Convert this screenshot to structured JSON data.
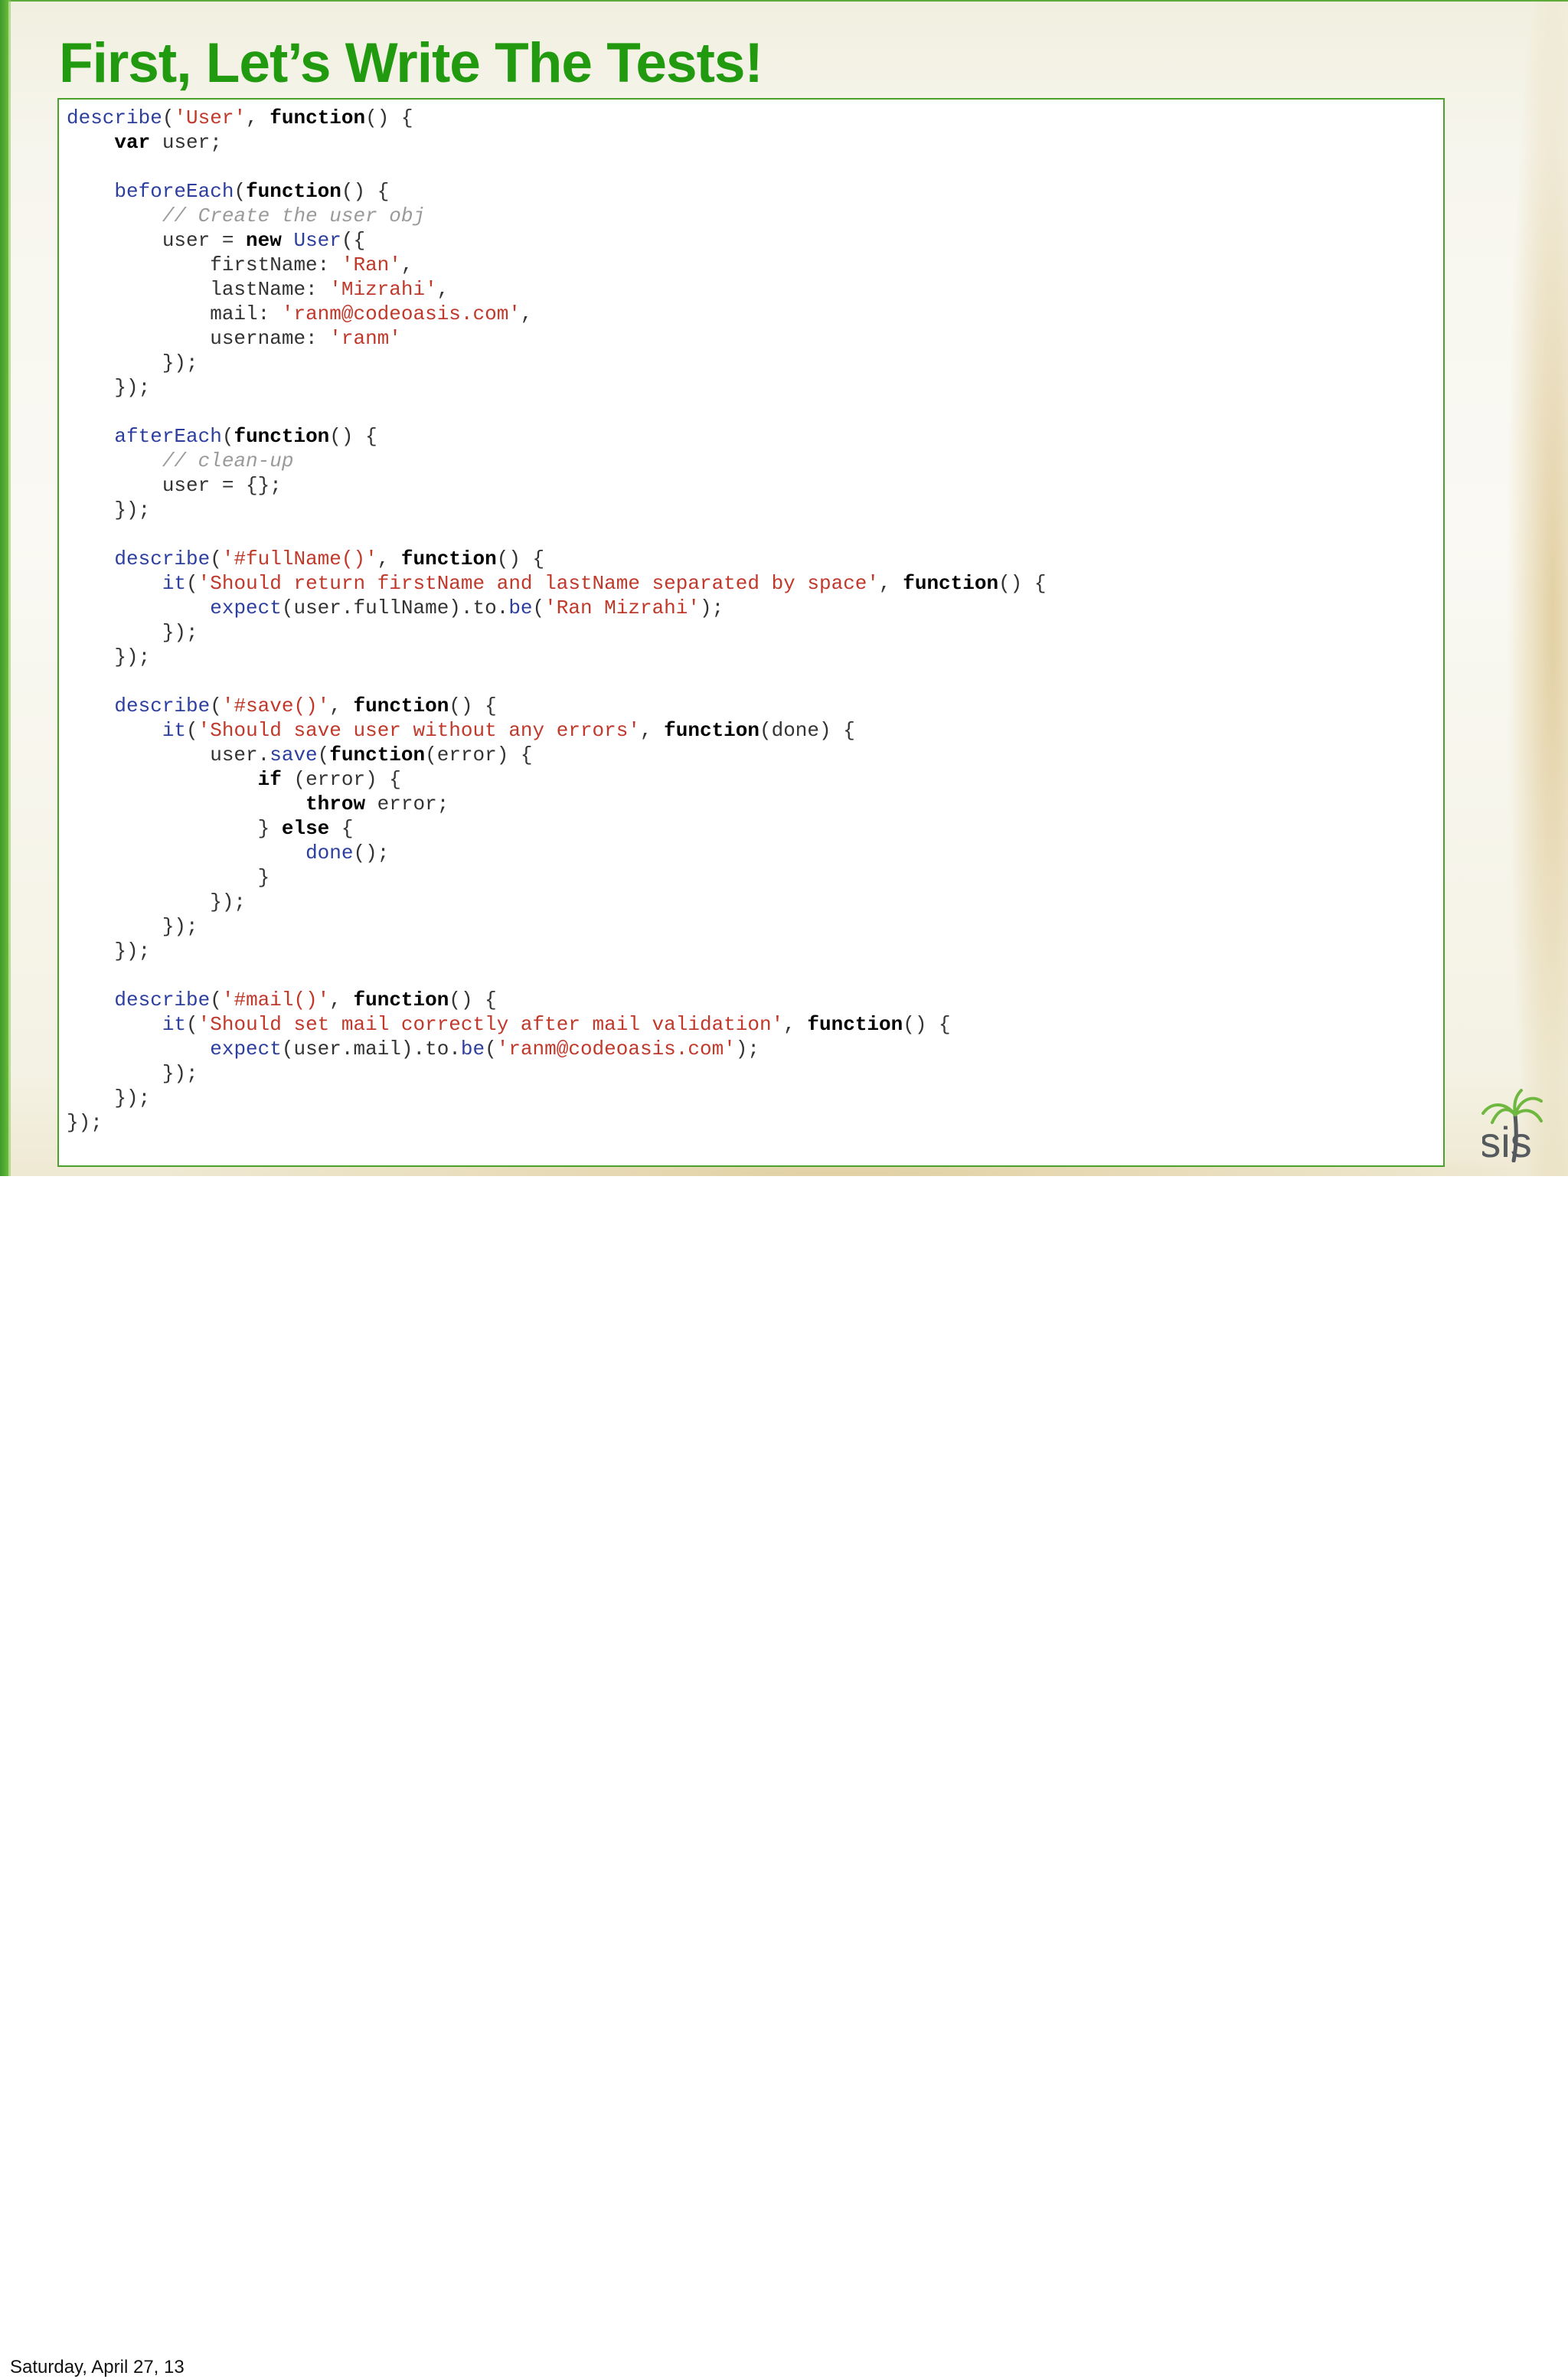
{
  "slide": {
    "title": "First, Let’s Write The Tests!",
    "code_lines": [
      [
        [
          "f",
          "describe"
        ],
        [
          "p",
          "("
        ],
        [
          "s",
          "'User'"
        ],
        [
          "p",
          ", "
        ],
        [
          "k",
          "function"
        ],
        [
          "p",
          "() {"
        ]
      ],
      [
        [
          "p",
          "    "
        ],
        [
          "k",
          "var"
        ],
        [
          "p",
          " user;"
        ]
      ],
      [],
      [
        [
          "p",
          "    "
        ],
        [
          "f",
          "beforeEach"
        ],
        [
          "p",
          "("
        ],
        [
          "k",
          "function"
        ],
        [
          "p",
          "() {"
        ]
      ],
      [
        [
          "p",
          "        "
        ],
        [
          "c",
          "// Create the user obj"
        ]
      ],
      [
        [
          "p",
          "        user = "
        ],
        [
          "k",
          "new"
        ],
        [
          "p",
          " "
        ],
        [
          "f",
          "User"
        ],
        [
          "p",
          "({"
        ]
      ],
      [
        [
          "p",
          "            firstName: "
        ],
        [
          "s",
          "'Ran'"
        ],
        [
          "p",
          ","
        ]
      ],
      [
        [
          "p",
          "            lastName: "
        ],
        [
          "s",
          "'Mizrahi'"
        ],
        [
          "p",
          ","
        ]
      ],
      [
        [
          "p",
          "            mail: "
        ],
        [
          "s",
          "'ranm@codeoasis.com'"
        ],
        [
          "p",
          ","
        ]
      ],
      [
        [
          "p",
          "            username: "
        ],
        [
          "s",
          "'ranm'"
        ]
      ],
      [
        [
          "p",
          "        });"
        ]
      ],
      [
        [
          "p",
          "    });"
        ]
      ],
      [],
      [
        [
          "p",
          "    "
        ],
        [
          "f",
          "afterEach"
        ],
        [
          "p",
          "("
        ],
        [
          "k",
          "function"
        ],
        [
          "p",
          "() {"
        ]
      ],
      [
        [
          "p",
          "        "
        ],
        [
          "c",
          "// clean-up"
        ]
      ],
      [
        [
          "p",
          "        user = {};"
        ]
      ],
      [
        [
          "p",
          "    });"
        ]
      ],
      [],
      [
        [
          "p",
          "    "
        ],
        [
          "f",
          "describe"
        ],
        [
          "p",
          "("
        ],
        [
          "s",
          "'#fullName()'"
        ],
        [
          "p",
          ", "
        ],
        [
          "k",
          "function"
        ],
        [
          "p",
          "() {"
        ]
      ],
      [
        [
          "p",
          "        "
        ],
        [
          "f",
          "it"
        ],
        [
          "p",
          "("
        ],
        [
          "s",
          "'Should return firstName and lastName separated by space'"
        ],
        [
          "p",
          ", "
        ],
        [
          "k",
          "function"
        ],
        [
          "p",
          "() {"
        ]
      ],
      [
        [
          "p",
          "            "
        ],
        [
          "f",
          "expect"
        ],
        [
          "p",
          "(user.fullName).to."
        ],
        [
          "f",
          "be"
        ],
        [
          "p",
          "("
        ],
        [
          "s",
          "'Ran Mizrahi'"
        ],
        [
          "p",
          ");"
        ]
      ],
      [
        [
          "p",
          "        });"
        ]
      ],
      [
        [
          "p",
          "    });"
        ]
      ],
      [],
      [
        [
          "p",
          "    "
        ],
        [
          "f",
          "describe"
        ],
        [
          "p",
          "("
        ],
        [
          "s",
          "'#save()'"
        ],
        [
          "p",
          ", "
        ],
        [
          "k",
          "function"
        ],
        [
          "p",
          "() {"
        ]
      ],
      [
        [
          "p",
          "        "
        ],
        [
          "f",
          "it"
        ],
        [
          "p",
          "("
        ],
        [
          "s",
          "'Should save user without any errors'"
        ],
        [
          "p",
          ", "
        ],
        [
          "k",
          "function"
        ],
        [
          "p",
          "(done) {"
        ]
      ],
      [
        [
          "p",
          "            user."
        ],
        [
          "f",
          "save"
        ],
        [
          "p",
          "("
        ],
        [
          "k",
          "function"
        ],
        [
          "p",
          "(error) {"
        ]
      ],
      [
        [
          "p",
          "                "
        ],
        [
          "k",
          "if"
        ],
        [
          "p",
          " (error) {"
        ]
      ],
      [
        [
          "p",
          "                    "
        ],
        [
          "k",
          "throw"
        ],
        [
          "p",
          " error;"
        ]
      ],
      [
        [
          "p",
          "                } "
        ],
        [
          "k",
          "else"
        ],
        [
          "p",
          " {"
        ]
      ],
      [
        [
          "p",
          "                    "
        ],
        [
          "f",
          "done"
        ],
        [
          "p",
          "();"
        ]
      ],
      [
        [
          "p",
          "                }"
        ]
      ],
      [
        [
          "p",
          "            });"
        ]
      ],
      [
        [
          "p",
          "        });"
        ]
      ],
      [
        [
          "p",
          "    });"
        ]
      ],
      [],
      [
        [
          "p",
          "    "
        ],
        [
          "f",
          "describe"
        ],
        [
          "p",
          "("
        ],
        [
          "s",
          "'#mail()'"
        ],
        [
          "p",
          ", "
        ],
        [
          "k",
          "function"
        ],
        [
          "p",
          "() {"
        ]
      ],
      [
        [
          "p",
          "        "
        ],
        [
          "f",
          "it"
        ],
        [
          "p",
          "("
        ],
        [
          "s",
          "'Should set mail correctly after mail validation'"
        ],
        [
          "p",
          ", "
        ],
        [
          "k",
          "function"
        ],
        [
          "p",
          "() {"
        ]
      ],
      [
        [
          "p",
          "            "
        ],
        [
          "f",
          "expect"
        ],
        [
          "p",
          "(user.mail).to."
        ],
        [
          "f",
          "be"
        ],
        [
          "p",
          "("
        ],
        [
          "s",
          "'ranm@codeoasis.com'"
        ],
        [
          "p",
          ");"
        ]
      ],
      [
        [
          "p",
          "        });"
        ]
      ],
      [
        [
          "p",
          "    });"
        ]
      ],
      [
        [
          "p",
          "});"
        ]
      ]
    ],
    "logo_text": "oasis",
    "colors": {
      "title": "#219a10",
      "border": "#4aa22c",
      "keyword": "#000000",
      "function_name": "#2d3f9e",
      "string": "#c0392b",
      "comment": "#9a9a9a"
    }
  },
  "footer": {
    "date": "Saturday, April 27, 13"
  },
  "icons": [
    "palm-tree-icon"
  ]
}
